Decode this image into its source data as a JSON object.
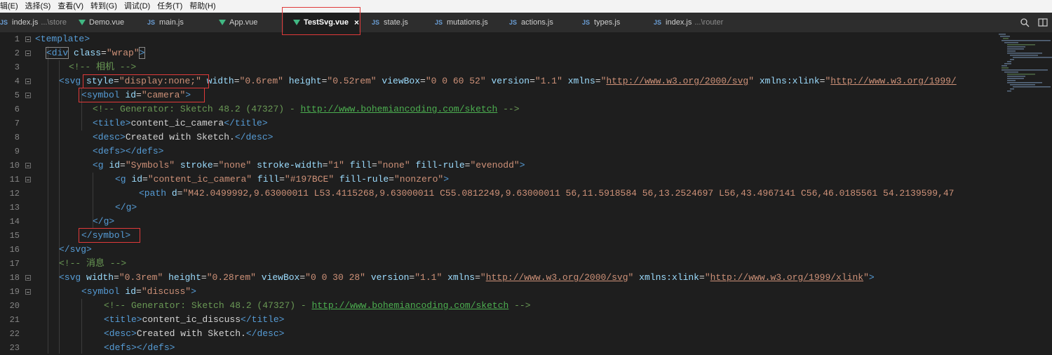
{
  "menu": [
    "辑(E)",
    "选择(S)",
    "查看(V)",
    "转到(G)",
    "调试(D)",
    "任务(T)",
    "帮助(H)"
  ],
  "tabs": [
    {
      "icon": "JS",
      "label": "index.js",
      "sub": "...\\store"
    },
    {
      "icon": "vue",
      "label": "Demo.vue",
      "sub": ""
    },
    {
      "icon": "JS",
      "label": "main.js",
      "sub": ""
    },
    {
      "icon": "vue",
      "label": "App.vue",
      "sub": ""
    },
    {
      "icon": "vue",
      "label": "TestSvg.vue",
      "sub": "",
      "close": "×"
    },
    {
      "icon": "JS",
      "label": "state.js",
      "sub": ""
    },
    {
      "icon": "JS",
      "label": "mutations.js",
      "sub": ""
    },
    {
      "icon": "JS",
      "label": "actions.js",
      "sub": ""
    },
    {
      "icon": "JS",
      "label": "types.js",
      "sub": ""
    },
    {
      "icon": "JS",
      "label": "index.js",
      "sub": "...\\router"
    }
  ],
  "line_numbers": [
    "1",
    "2",
    "3",
    "4",
    "5",
    "6",
    "7",
    "8",
    "9",
    "10",
    "11",
    "12",
    "13",
    "14",
    "15",
    "16",
    "17",
    "18",
    "19",
    "20",
    "21",
    "22",
    "23"
  ],
  "code": {
    "l1": {
      "tag": "<template>"
    },
    "l2": {
      "open": "<div",
      "attr": " class",
      "eq": "=",
      "val": "\"wrap\"",
      "close": ">"
    },
    "l3": {
      "comment": "<!-- 相机 -->"
    },
    "l4": {
      "open": "<svg",
      "a1": "style",
      "v1": "\"display:none;\"",
      "a2": "width",
      "v2": "\"0.6rem\"",
      "a3": "height",
      "v3": "\"0.52rem\"",
      "a4": "viewBox",
      "v4": "\"0 0 60 52\"",
      "a5": "version",
      "v5": "\"1.1\"",
      "a6": "xmlns",
      "u6": "http://www.w3.org/2000/svg",
      "a7": "xmlns:xlink",
      "u7": "http://www.w3.org/1999/"
    },
    "l5": {
      "open": "<symbol",
      "a1": "id",
      "v1": "\"camera\"",
      "close": ">"
    },
    "l6": {
      "comment1": "<!-- Generator: Sketch 48.2 (47327) - ",
      "link": "http://www.bohemiancoding.com/sketch",
      "comment2": " -->"
    },
    "l7": {
      "open": "<title>",
      "text": "content_ic_camera",
      "close": "</title>"
    },
    "l8": {
      "open": "<desc>",
      "text": "Created with Sketch.",
      "close": "</desc>"
    },
    "l9": {
      "text": "<defs></defs>"
    },
    "l10": {
      "open": "<g",
      "a1": "id",
      "v1": "\"Symbols\"",
      "a2": "stroke",
      "v2": "\"none\"",
      "a3": "stroke-width",
      "v3": "\"1\"",
      "a4": "fill",
      "v4": "\"none\"",
      "a5": "fill-rule",
      "v5": "\"evenodd\"",
      "close": ">"
    },
    "l11": {
      "open": "<g",
      "a1": "id",
      "v1": "\"content_ic_camera\"",
      "a2": "fill",
      "v2": "\"#197BCE\"",
      "a3": "fill-rule",
      "v3": "\"nonzero\"",
      "close": ">"
    },
    "l12": {
      "open": "<path",
      "a1": "d",
      "v1": "\"M42.0499992,9.63000011 L53.4115268,9.63000011 C55.0812249,9.63000011 56,11.5918584 56,13.2524697 L56,43.4967141 C56,46.0185561 54.2139599,47"
    },
    "l13": {
      "text": "</g>"
    },
    "l14": {
      "text": "</g>"
    },
    "l15": {
      "text": "</symbol>"
    },
    "l16": {
      "text": "</svg>"
    },
    "l17": {
      "comment": "<!-- 消息 -->"
    },
    "l18": {
      "open": "<svg",
      "a1": "width",
      "v1": "\"0.3rem\"",
      "a2": "height",
      "v2": "\"0.28rem\"",
      "a3": "viewBox",
      "v3": "\"0 0 30 28\"",
      "a4": "version",
      "v4": "\"1.1\"",
      "a5": "xmlns",
      "u5": "http://www.w3.org/2000/svg",
      "a6": "xmlns:xlink",
      "u6": "http://www.w3.org/1999/xlink",
      "close": ">"
    },
    "l19": {
      "open": "<symbol",
      "a1": "id",
      "v1": "\"discuss\"",
      "close": ">"
    },
    "l20": {
      "comment1": "<!-- Generator: Sketch 48.2 (47327) - ",
      "link": "http://www.bohemiancoding.com/sketch",
      "comment2": " -->"
    },
    "l21": {
      "open": "<title>",
      "text": "content_ic_discuss",
      "close": "</title>"
    },
    "l22": {
      "open": "<desc>",
      "text": "Created with Sketch.",
      "close": "</desc>"
    },
    "l23": {
      "text": "<defs></defs>"
    }
  },
  "colors": {
    "tag": "#569cd6",
    "attribute": "#9cdcfe",
    "string": "#ce9178",
    "comment": "#6a9955",
    "highlight": "#e03a3a",
    "vue": "#41b883"
  }
}
